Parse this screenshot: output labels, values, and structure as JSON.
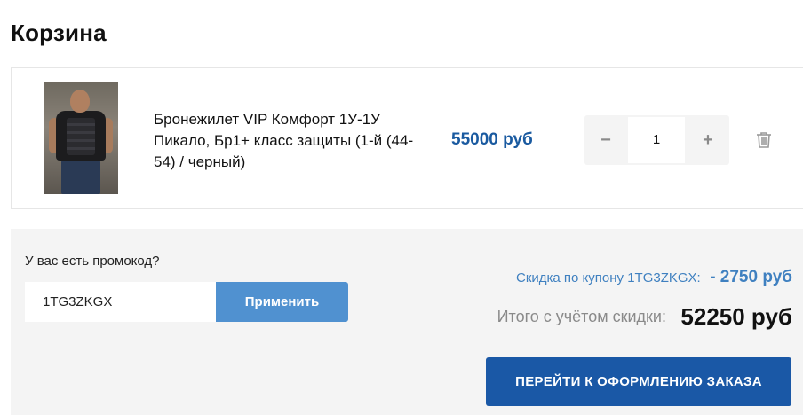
{
  "page": {
    "title": "Корзина"
  },
  "cart": {
    "items": [
      {
        "name": "Бронежилет VIP Комфорт 1У-1У Пикало, Бр1+ класс защиты (1-й (44-54) / черный)",
        "price": "55000 руб",
        "quantity": "1",
        "qty_minus": "−",
        "qty_plus": "+",
        "image_icon": "product-photo-man-in-black-vest",
        "delete_icon": "trash-icon"
      }
    ]
  },
  "promo": {
    "label": "У вас есть промокод?",
    "code_value": "1TG3ZKGX",
    "apply_label": "Применить"
  },
  "summary": {
    "discount_label": "Скидка по купону 1TG3ZKGX:",
    "discount_value": "- 2750 руб",
    "total_label": "Итого с учётом скидки:",
    "total_value": "52250 руб",
    "checkout_label": "ПЕРЕЙТИ К ОФОРМЛЕНИЮ ЗАКАЗА"
  },
  "colors": {
    "price": "#1a5aa0",
    "discount": "#3f80c0",
    "apply_button": "#5091d0",
    "checkout_button": "#1a58a6",
    "summary_background": "#f4f4f4"
  }
}
